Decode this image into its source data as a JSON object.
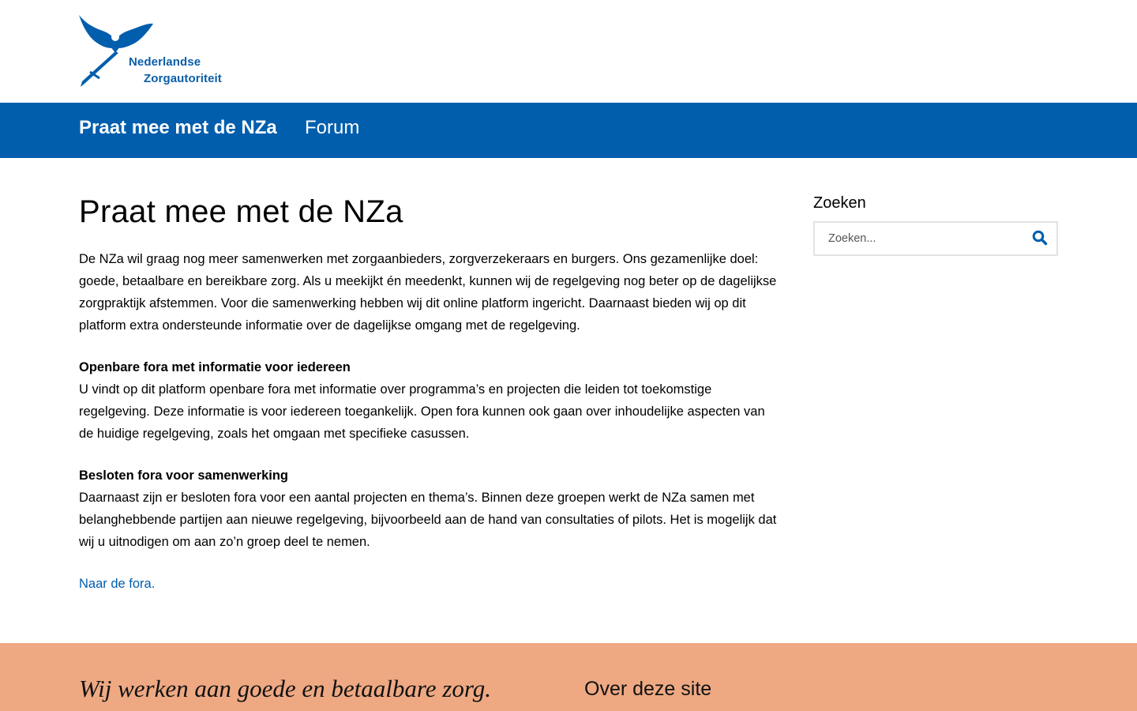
{
  "header": {
    "logo_line1": "Nederlandse",
    "logo_line2": "Zorgautoriteit"
  },
  "nav": {
    "brand": "Praat mee met de NZa",
    "items": [
      {
        "label": "Forum"
      }
    ]
  },
  "main": {
    "title": "Praat mee met de NZa",
    "intro": "De NZa wil graag nog meer samenwerken met zorgaanbieders, zorgverzekeraars en burgers. Ons gezamenlijke doel: goede, betaalbare en bereikbare zorg. Als u meekijkt én meedenkt, kunnen wij de regelgeving nog beter op de dagelijkse zorgpraktijk afstemmen. Voor die samenwerking hebben wij dit online platform ingericht. Daarnaast bieden wij op dit platform extra ondersteunde informatie over de dagelijkse omgang met de regelgeving.",
    "sections": [
      {
        "heading": "Openbare fora met informatie voor iedereen",
        "body": "U vindt op dit platform openbare fora met informatie over programma’s en projecten die leiden tot toekomstige regelgeving. Deze informatie is voor iedereen toegankelijk. Open fora kunnen ook gaan over inhoudelijke aspecten van de huidige regelgeving, zoals het omgaan met specifieke casussen."
      },
      {
        "heading": "Besloten fora voor samenwerking",
        "body": "Daarnaast zijn er besloten fora voor een aantal projecten en thema’s. Binnen deze groepen werkt de NZa samen met belanghebbende partijen aan nieuwe regelgeving, bijvoorbeeld aan de hand van consultaties of pilots. Het is mogelijk dat wij u uitnodigen om aan zo’n groep deel te nemen."
      }
    ],
    "link": "Naar de fora."
  },
  "sidebar": {
    "title": "Zoeken",
    "search_placeholder": "Zoeken...",
    "search_icon": "search-icon"
  },
  "footer": {
    "tagline": "Wij werken aan goede en betaalbare zorg.",
    "heading": "Over deze site"
  },
  "colors": {
    "brand_blue": "#005ead",
    "footer_bg": "#eea983"
  }
}
